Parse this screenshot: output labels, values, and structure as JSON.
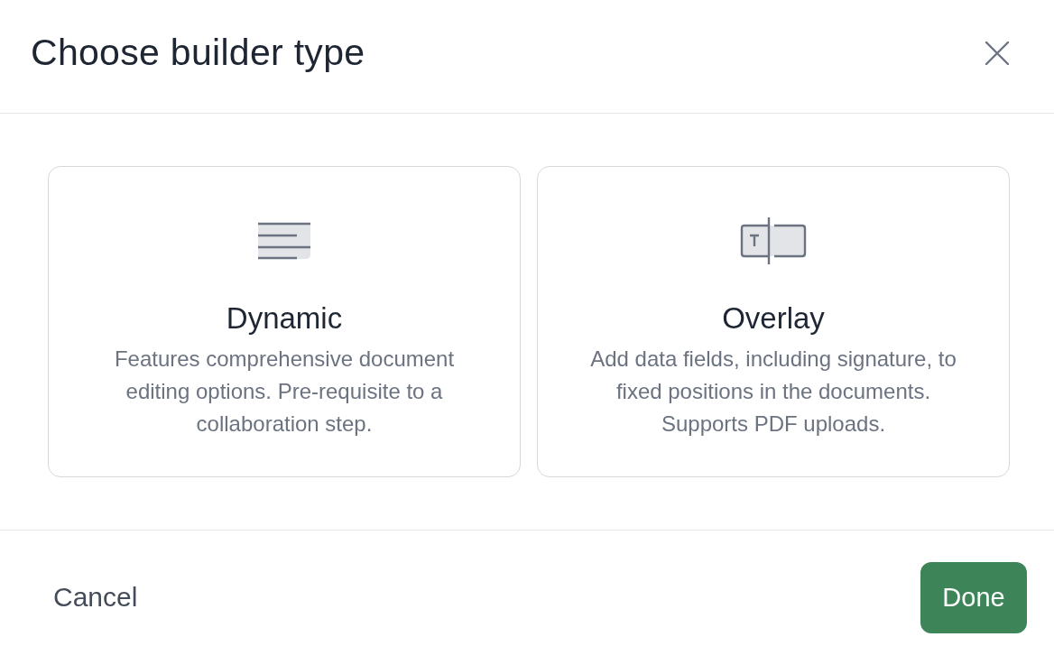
{
  "dialog": {
    "title": "Choose builder type"
  },
  "options": [
    {
      "kind": "dynamic",
      "title": "Dynamic",
      "description": "Features comprehensive document editing options. Pre-requisite to a collaboration step."
    },
    {
      "kind": "overlay",
      "title": "Overlay",
      "description": "Add data fields, including signature, to fixed positions in the documents. Supports PDF uploads."
    }
  ],
  "footer": {
    "cancel": "Cancel",
    "done": "Done"
  }
}
